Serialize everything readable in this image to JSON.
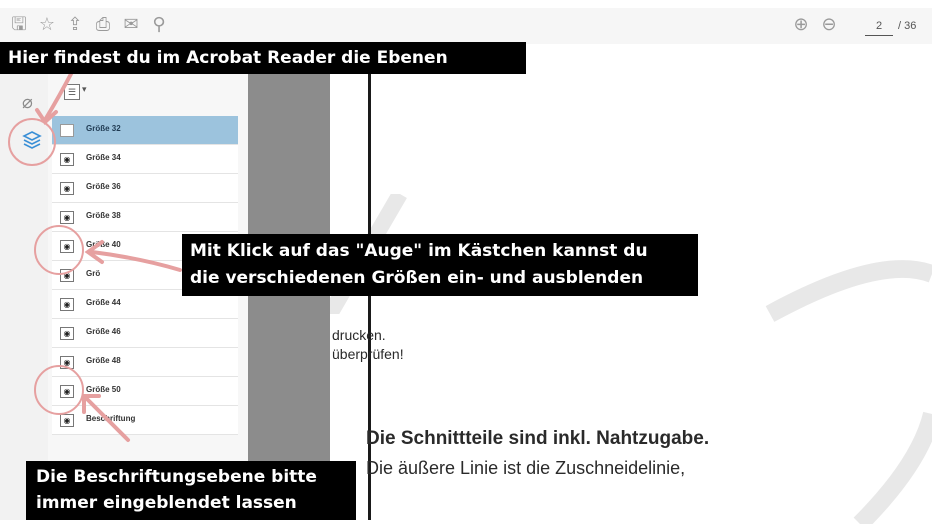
{
  "toolbar": {
    "icons": [
      "save-icon",
      "star-icon",
      "upload-icon",
      "print-icon",
      "mail-icon",
      "zoom-icon"
    ],
    "page_current": "2",
    "page_total": "/ 36"
  },
  "layers": {
    "items": [
      {
        "label": "Größe 32",
        "visible": false,
        "selected": true
      },
      {
        "label": "Größe 34",
        "visible": true,
        "selected": false
      },
      {
        "label": "Größe 36",
        "visible": true,
        "selected": false
      },
      {
        "label": "Größe 38",
        "visible": true,
        "selected": false
      },
      {
        "label": "Größe 40",
        "visible": true,
        "selected": false
      },
      {
        "label": "Grö",
        "visible": true,
        "selected": false
      },
      {
        "label": "Größe 44",
        "visible": true,
        "selected": false
      },
      {
        "label": "Größe 46",
        "visible": true,
        "selected": false
      },
      {
        "label": "Größe 48",
        "visible": true,
        "selected": false
      },
      {
        "label": "Größe 50",
        "visible": true,
        "selected": false
      },
      {
        "label": "Beschriftung",
        "visible": true,
        "selected": false
      }
    ]
  },
  "document": {
    "line1": "drucken.",
    "line2": "überprüfen!",
    "heading": "Die Schnittteile sind inkl. Nahtzugabe.",
    "body": "Die äußere Linie ist die Zuschneidelinie,"
  },
  "callouts": {
    "top": "Hier findest du im Acrobat Reader die Ebenen",
    "middle_line1": "Mit Klick auf das \"Auge\" im Kästchen kannst du",
    "middle_line2": "die verschiedenen Größen ein- und ausblenden",
    "bottom_line1": "Die Beschriftungsebene bitte",
    "bottom_line2": "immer eingeblendet lassen"
  },
  "colors": {
    "accent_circle": "#e6a0a0",
    "selected_row": "#9cc3dd",
    "layers_icon": "#3a8fd6"
  }
}
